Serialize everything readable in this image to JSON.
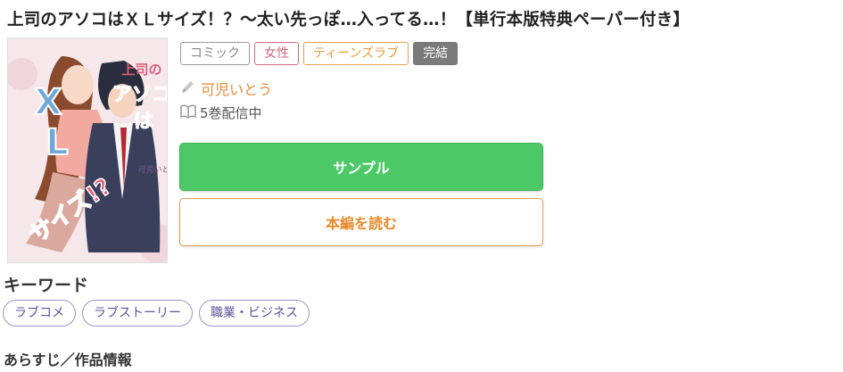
{
  "title": "上司のアソコはＸＬサイズ！？～太い先っぽ…入ってる…！【単行本版特典ペーパー付き】",
  "cover": {
    "title_text": "上司のアソコはXLサイズ!?",
    "subtitle_text": "太い先っぽ…入ってる",
    "author_text": "可児いとう",
    "colors": {
      "bg": "#f7e9ec",
      "title": "#e0607a",
      "xl": "#6fa8d8"
    }
  },
  "tags": [
    {
      "label": "コミック",
      "style": "gray"
    },
    {
      "label": "女性",
      "style": "pink"
    },
    {
      "label": "ティーンズラブ",
      "style": "orange"
    },
    {
      "label": "完結",
      "style": "done"
    }
  ],
  "author": {
    "icon": "pen-icon",
    "name": "可児いとう"
  },
  "volumes": {
    "icon": "book-icon",
    "text": "5巻配信中"
  },
  "buttons": {
    "sample": "サンプル",
    "read": "本編を読む"
  },
  "keywords": {
    "heading": "キーワード",
    "items": [
      "ラブコメ",
      "ラブストーリー",
      "職業・ビジネス"
    ]
  },
  "synopsis_heading": "あらすじ／作品情報",
  "colors": {
    "accent_green": "#4cc866",
    "accent_orange": "#e88a2a",
    "keyword_border": "#9c93c9"
  }
}
